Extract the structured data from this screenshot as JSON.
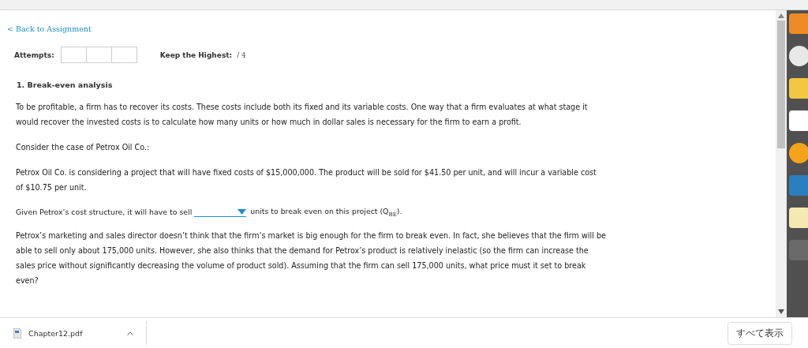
{
  "back_link": "< Back to Assignment",
  "attempts": {
    "label": "Attempts:"
  },
  "keep": {
    "label": "Keep the Highest:",
    "value": "/ 4"
  },
  "question": {
    "title": "1. Break-even analysis",
    "paragraphs": [
      "To be profitable, a firm has to recover its costs. These costs include both its fixed and its variable costs. One way that a firm evaluates at what stage it would recover the invested costs is to calculate how many units or how much in dollar sales is necessary for the firm to earn a profit.",
      "Consider the case of Petrox Oil Co.:",
      "Petrox Oil Co. is considering a project that will have fixed costs of $15,000,000. The product will be sold for $41.50 per unit, and will incur a variable cost of $10.75 per unit."
    ],
    "blank_sentence": {
      "before": "Given Petrox’s cost structure, it will have to sell",
      "after": "units to break even on this project (Q$_{BE}$)."
    },
    "closing": "Petrox’s marketing and sales director doesn’t think that the firm’s market is big enough for the firm to break even. In fact, she believes that the firm will be able to sell only about 175,000 units. However, she also thinks that the demand for Petrox’s product is relatively inelastic (so the firm can increase the sales price without significantly decreasing the volume of product sold). Assuming that the firm can sell 175,000 units, what price must it set to break even?"
  },
  "downloads": {
    "file": "Chapter12.pdf",
    "show_all": "すべて表示"
  }
}
